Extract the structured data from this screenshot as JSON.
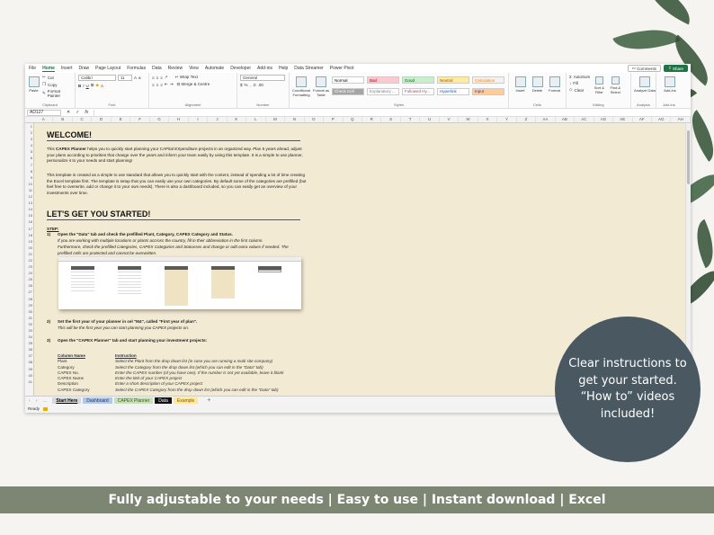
{
  "menu": [
    "File",
    "Home",
    "Insert",
    "Draw",
    "Page Layout",
    "Formulas",
    "Data",
    "Review",
    "View",
    "Automate",
    "Developer",
    "Help",
    "Data Streamer",
    "Power Pivot"
  ],
  "add_ins_tab": "Add-ins",
  "top_buttons": {
    "comments": "Comments",
    "share": "Share"
  },
  "ribbon": {
    "clipboard": {
      "paste": "Paste",
      "cut": "Cut",
      "copy": "Copy",
      "format_painter": "Format Painter",
      "label": "Clipboard"
    },
    "font": {
      "name": "Calibri",
      "size": "11",
      "label": "Font"
    },
    "alignment": {
      "wrap": "Wrap Text",
      "merge": "Merge & Centre",
      "label": "Alignment"
    },
    "number": {
      "format": "General",
      "label": "Number"
    },
    "styles": {
      "conditional": "Conditional Formatting",
      "format_table": "Format as Table",
      "cells": [
        {
          "label": "Normal",
          "bg": "#ffffff",
          "fg": "#000000"
        },
        {
          "label": "Bad",
          "bg": "#ffc7ce",
          "fg": "#9c0006"
        },
        {
          "label": "Good",
          "bg": "#c6efce",
          "fg": "#006100"
        },
        {
          "label": "Neutral",
          "bg": "#ffeb9c",
          "fg": "#9c5700"
        },
        {
          "label": "Calculation",
          "bg": "#f2f2f2",
          "fg": "#fa7d00"
        },
        {
          "label": "Check Cell",
          "bg": "#a5a5a5",
          "fg": "#ffffff"
        },
        {
          "label": "Explanatory ...",
          "bg": "#ffffff",
          "fg": "#7f7f7f"
        },
        {
          "label": "Followed Hy...",
          "bg": "#ffffff",
          "fg": "#954f72"
        },
        {
          "label": "Hyperlink",
          "bg": "#ffffff",
          "fg": "#0563c1"
        },
        {
          "label": "Input",
          "bg": "#ffcc99",
          "fg": "#3f3f76"
        }
      ],
      "label": "Styles"
    },
    "cells_group": {
      "insert": "Insert",
      "delete": "Delete",
      "format": "Format",
      "label": "Cells"
    },
    "editing": {
      "autosum": "AutoSum",
      "fill": "Fill",
      "clear": "Clear",
      "sort": "Sort & Filter",
      "find": "Find & Select",
      "label": "Editing"
    },
    "analysis": {
      "analyze": "Analyze Data",
      "label": "Analysis"
    },
    "addins": {
      "btn": "Add-ins",
      "label": "Add-ins"
    }
  },
  "formula_bar": {
    "cell_ref": "AD127",
    "fx": "fx"
  },
  "columns": [
    "A",
    "B",
    "C",
    "D",
    "E",
    "F",
    "G",
    "H",
    "I",
    "J",
    "K",
    "L",
    "M",
    "N",
    "O",
    "P",
    "Q",
    "R",
    "S",
    "T",
    "U",
    "V",
    "W",
    "X",
    "Y",
    "Z",
    "AA",
    "AB",
    "AC",
    "AD",
    "AE",
    "AF",
    "AG",
    "AH"
  ],
  "rows": [
    "1",
    "2",
    "3",
    "4",
    "5",
    "6",
    "7",
    "8",
    "9",
    "10",
    "11",
    "12",
    "13",
    "14",
    "15",
    "16",
    "17",
    "18",
    "19",
    "20",
    "21",
    "22",
    "23",
    "24",
    "25",
    "26",
    "27",
    "28",
    "29",
    "30",
    "31",
    "32",
    "33",
    "34",
    "35",
    "36",
    "37",
    "38",
    "39",
    "40",
    "41"
  ],
  "sheet": {
    "welcome": "WELCOME!",
    "intro_strong": "CAPEX Planner",
    "intro_pre": "This ",
    "intro_post": " helps you to quickly start planning your CAPital EXpenditure projects in an organized way. Plan 5 years ahead, adjust your plans according to priorities that change over the years and inform your team easily by using this template. It is a simple to use planner, personalize it to your needs and start planning!",
    "intro2": "This template is created as a simple to use standard that allows you to quickly start with the content, instead of spending a lot of time creating the Excel template first. The template is setup that you can easily use your own categories. By default some of the categories are prefilled (but feel free to overwrite, add or change it to your own needs). There is also a dashboard included, so you can easily get an overview of your investments over time.",
    "started": "LET'S GET YOU STARTED!",
    "step_label": "STEP:",
    "step1_num": "1)",
    "step1_title": "Open the \"Data\" tab and check the prefilled Plant, Category, CAPEX Category and Status.",
    "step1_l1": "If you are working with multiple locations or plants accross the country, fill in their abbreviation in the first column.",
    "step1_l2": "Furthermore, check the prefilled Categories, CAPEX Categories and Statusses and change or add extra values if needed. The",
    "step1_l3": "prefilled cells are protected and cannot be overwritten.",
    "step2_num": "2)",
    "step2_title": "Set the first year of your planner in cel \"M4\", called \"First year of plan\".",
    "step2_l1": "This will be the first year you can start planning you CAPEX projects on.",
    "step3_num": "3)",
    "step3_title": "Open the \"CAPEX Planner\" tab and start planning your investment projects:",
    "table": {
      "header": [
        "Column Name",
        "Instruction"
      ],
      "rows": [
        [
          "Plant",
          "Select the Plant from the drop down list (in case you are running a multi site company)"
        ],
        [
          "Category",
          "Select the Category from the drop down list (which you can edit in the \"Data\" tab)"
        ],
        [
          "CAPEX No.",
          "Enter the CAPEX number (of you have one). If the number is not yet available, leave it blank"
        ],
        [
          "CAPEX Name",
          "Enter the titel of your CAPEX project"
        ],
        [
          "Description",
          "Enter a short description of your CAPEX project"
        ],
        [
          "CAPEX Category",
          "Select the CAPEX Category from the drop down list (which you can edit in the \"Data\" tab)"
        ]
      ]
    }
  },
  "sheet_tabs": [
    {
      "label": "Start Here",
      "bg": "#d9d9d9",
      "fg": "#000000"
    },
    {
      "label": "Dashboard",
      "bg": "#b4c7e7",
      "fg": "#1f3864"
    },
    {
      "label": "CAPEX Planner",
      "bg": "#c9dfb7",
      "fg": "#375623"
    },
    {
      "label": "Data",
      "bg": "#111111",
      "fg": "#ffffff"
    },
    {
      "label": "Example",
      "bg": "#ffe699",
      "fg": "#7f6000"
    }
  ],
  "add_sheet": "+",
  "status": "Ready",
  "callout": "Clear instructions to get your started. “How to” videos included!",
  "banner": "Fully adjustable to your needs | Easy to use | Instant download | Excel",
  "colors": {
    "excel_green": "#217346",
    "sheet_bg": "#f2ead3",
    "circle": "#4a5961",
    "banner": "#7d8573"
  }
}
